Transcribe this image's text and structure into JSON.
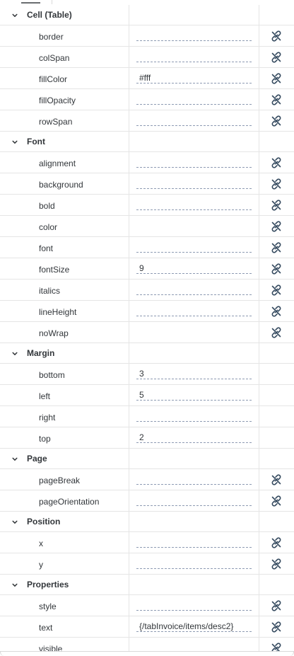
{
  "colors": {
    "text": "#32363a",
    "icon": "#354a5f",
    "row_border": "#e5e5e5",
    "input_underline": "#8e9bb3"
  },
  "groups": [
    {
      "title": "Cell (Table)",
      "expanded": true,
      "properties": [
        {
          "name": "border",
          "value": "",
          "has_input": true,
          "icon": "unlink-icon"
        },
        {
          "name": "colSpan",
          "value": "",
          "has_input": true,
          "icon": "unlink-icon"
        },
        {
          "name": "fillColor",
          "value": "#fff",
          "has_input": true,
          "icon": "unlink-icon"
        },
        {
          "name": "fillOpacity",
          "value": "",
          "has_input": true,
          "icon": "unlink-icon"
        },
        {
          "name": "rowSpan",
          "value": "",
          "has_input": true,
          "icon": "unlink-icon"
        }
      ]
    },
    {
      "title": "Font",
      "expanded": true,
      "properties": [
        {
          "name": "alignment",
          "value": "",
          "has_input": true,
          "icon": "unlink-icon"
        },
        {
          "name": "background",
          "value": "",
          "has_input": true,
          "icon": "unlink-icon"
        },
        {
          "name": "bold",
          "value": "",
          "has_input": true,
          "icon": "unlink-icon"
        },
        {
          "name": "color",
          "value": "",
          "has_input": false,
          "icon": "unlink-icon"
        },
        {
          "name": "font",
          "value": "",
          "has_input": true,
          "icon": "unlink-icon"
        },
        {
          "name": "fontSize",
          "value": "9",
          "has_input": true,
          "icon": "unlink-icon"
        },
        {
          "name": "italics",
          "value": "",
          "has_input": true,
          "icon": "unlink-icon"
        },
        {
          "name": "lineHeight",
          "value": "",
          "has_input": true,
          "icon": "unlink-icon"
        },
        {
          "name": "noWrap",
          "value": "",
          "has_input": false,
          "icon": "unlink-icon"
        }
      ]
    },
    {
      "title": "Margin",
      "expanded": true,
      "properties": [
        {
          "name": "bottom",
          "value": "3",
          "has_input": true,
          "icon": ""
        },
        {
          "name": "left",
          "value": "5",
          "has_input": true,
          "icon": ""
        },
        {
          "name": "right",
          "value": "",
          "has_input": true,
          "icon": ""
        },
        {
          "name": "top",
          "value": "2",
          "has_input": true,
          "icon": ""
        }
      ]
    },
    {
      "title": "Page",
      "expanded": true,
      "properties": [
        {
          "name": "pageBreak",
          "value": "",
          "has_input": true,
          "icon": "unlink-icon"
        },
        {
          "name": "pageOrientation",
          "value": "",
          "has_input": true,
          "icon": "unlink-icon"
        }
      ]
    },
    {
      "title": "Position",
      "expanded": true,
      "properties": [
        {
          "name": "x",
          "value": "",
          "has_input": true,
          "icon": "unlink-icon"
        },
        {
          "name": "y",
          "value": "",
          "has_input": true,
          "icon": "unlink-icon"
        }
      ]
    },
    {
      "title": "Properties",
      "expanded": true,
      "properties": [
        {
          "name": "style",
          "value": "",
          "has_input": true,
          "icon": "unlink-icon"
        },
        {
          "name": "text",
          "value": "{/tabInvoice/items/desc2}",
          "has_input": true,
          "icon": "unlink-icon"
        },
        {
          "name": "visible",
          "value": "",
          "has_input": true,
          "icon": "unlink-icon"
        }
      ]
    }
  ]
}
